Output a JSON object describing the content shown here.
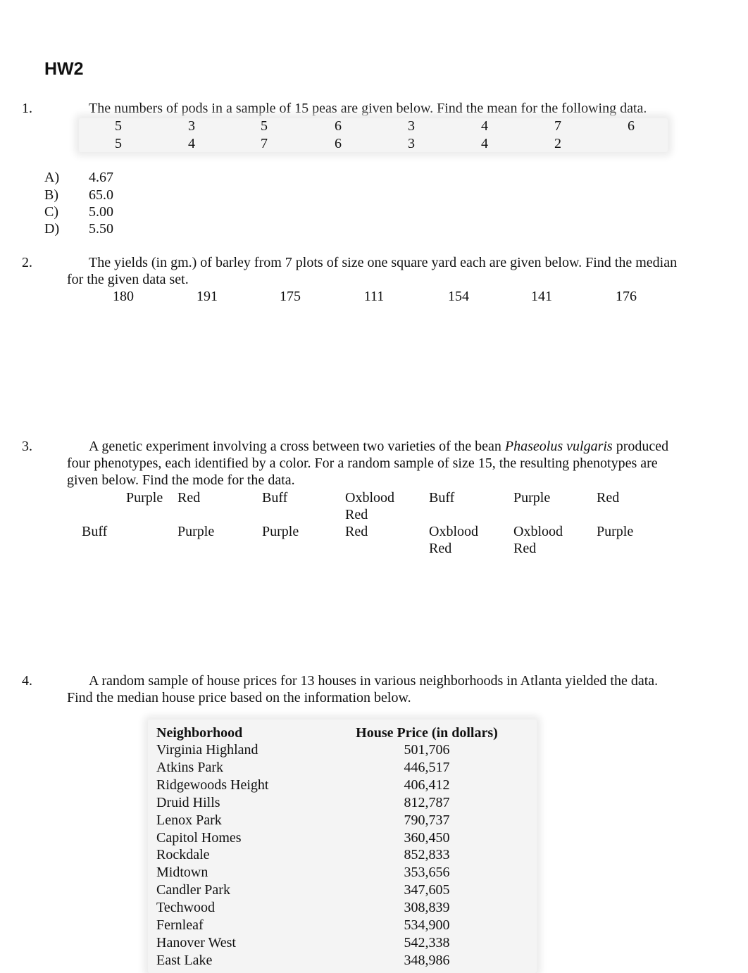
{
  "title": "HW2",
  "questions": [
    {
      "number": "1.",
      "text": "The numbers of pods in a sample of 15 peas are given below. Find the mean for the following data.",
      "data_rows": [
        [
          "5",
          "3",
          "5",
          "6",
          "3",
          "4",
          "7",
          "6"
        ],
        [
          "5",
          "4",
          "7",
          "6",
          "3",
          "4",
          "2",
          ""
        ]
      ],
      "options": [
        {
          "letter": "A)",
          "value": "4.67"
        },
        {
          "letter": "B)",
          "value": "65.0"
        },
        {
          "letter": "C)",
          "value": "5.00"
        },
        {
          "letter": "D)",
          "value": "5.50"
        }
      ]
    },
    {
      "number": "2.",
      "text_line1": "The yields (in gm.) of barley from 7 plots of size one square yard each are given below. Find the median",
      "text_line2": "for the given data set.",
      "data": [
        "180",
        "191",
        "175",
        "111",
        "154",
        "141",
        "176"
      ]
    },
    {
      "number": "3.",
      "text_line1_pre": "A genetic experiment involving a cross between two varieties of the bean ",
      "text_line1_italic": "Phaseolus vulgaris",
      "text_line1_post": " produced",
      "text_line2": "four phenotypes, each identified by a color. For a random sample of size 15, the resulting phenotypes are",
      "text_line3": "given below. Find the mode for the data.",
      "data_rows": [
        [
          "Purple",
          "Red",
          "Buff",
          "Oxblood Red",
          "Buff",
          "Purple",
          "Red"
        ],
        [
          "Buff",
          "Purple",
          "Purple",
          "Red",
          "Oxblood Red",
          "Oxblood Red",
          "Purple"
        ]
      ]
    },
    {
      "number": "4.",
      "text_line1": "A random sample of house prices for 13 houses in various neighborhoods in Atlanta yielded the data.",
      "text_line2": "Find the median house price based on the information below.",
      "table": {
        "headers": [
          "Neighborhood",
          "House Price (in dollars)"
        ],
        "rows": [
          [
            "Virginia Highland",
            "501,706"
          ],
          [
            "Atkins Park",
            "446,517"
          ],
          [
            "Ridgewoods Height",
            "406,412"
          ],
          [
            "Druid Hills",
            "812,787"
          ],
          [
            "Lenox Park",
            "790,737"
          ],
          [
            "Capitol Homes",
            "360,450"
          ],
          [
            "Rockdale",
            "852,833"
          ],
          [
            "Midtown",
            "353,656"
          ],
          [
            "Candler Park",
            "347,605"
          ],
          [
            "Techwood",
            "308,839"
          ],
          [
            "Fernleaf",
            "534,900"
          ],
          [
            "Hanover West",
            "542,338"
          ],
          [
            "East Lake",
            "348,986"
          ]
        ]
      }
    }
  ]
}
